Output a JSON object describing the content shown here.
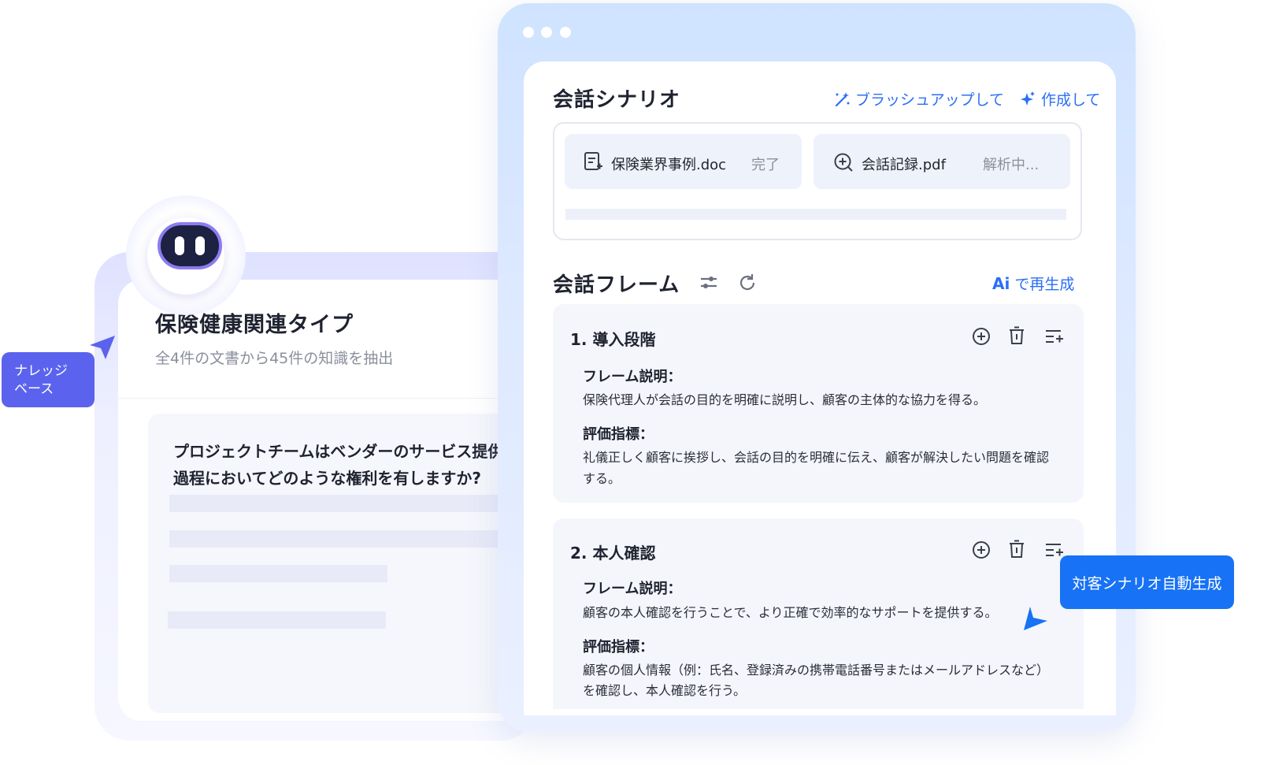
{
  "knowledge_panel": {
    "title": "保険健康関連タイプ",
    "subtitle": "全4件の文書から45件の知識を抽出",
    "question_line1": "プロジェクトチームはベンダーのサービス提供",
    "question_line2": "過程においてどのような権利を有しますか?",
    "tag_line1": "ナレッジ",
    "tag_line2": "ベース"
  },
  "scenario": {
    "title": "会話シナリオ",
    "brushup_label": "ブラッシュアップして",
    "create_label": "作成して",
    "files": [
      {
        "name": "保険業界事例.doc",
        "status": "完了"
      },
      {
        "name": "会話記録.pdf",
        "status": "解析中..."
      }
    ]
  },
  "frame": {
    "title": "会話フレーム",
    "ai_badge": "Ai",
    "regenerate_label": "で再生成",
    "stages": [
      {
        "title": "1. 導入段階",
        "desc_label": "フレーム説明：",
        "desc": "保険代理人が会話の目的を明確に説明し、顧客の主体的な協力を得る。",
        "metric_label": "評価指標：",
        "metric_line1": "礼儀正しく顧客に挨拶し、会話の目的を明確に伝え、顧客が解決したい問題を確認",
        "metric_line2": "する。"
      },
      {
        "title": "2. 本人確認",
        "desc_label": "フレーム説明：",
        "desc": "顧客の本人確認を行うことで、より正確で効率的なサポートを提供する。",
        "metric_label": "評価指標：",
        "metric_line1": "顧客の個人情報（例：氏名、登録済みの携帯電話番号またはメールアドレスなど）",
        "metric_line2": "を確認し、本人確認を行う。"
      }
    ]
  },
  "callout": {
    "label": "対客シナリオ自動生成"
  },
  "colors": {
    "accent_blue": "#2b6ef6",
    "tag_purple": "#5b63ee",
    "tag_blue": "#1772f5"
  }
}
